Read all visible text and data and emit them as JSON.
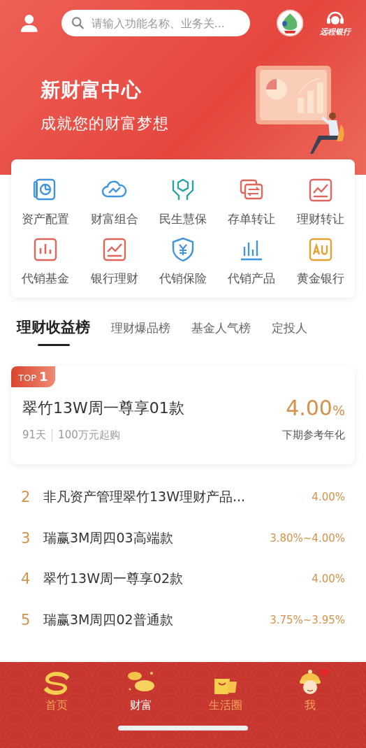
{
  "header": {
    "search": {
      "placeholder": "请输入功能名称、业务关..."
    },
    "remote_bank": "远程银行"
  },
  "banner": {
    "title": "新财富中心",
    "subtitle": "成就您的财富梦想"
  },
  "quick_menu": [
    {
      "label": "资产配置",
      "color": "#3f95dd"
    },
    {
      "label": "财富组合",
      "color": "#3f95dd"
    },
    {
      "label": "民生慧保",
      "color": "#2aa3a3"
    },
    {
      "label": "存单转让",
      "color": "#e0655b"
    },
    {
      "label": "理财转让",
      "color": "#e0655b"
    },
    {
      "label": "代销基金",
      "color": "#e0655b"
    },
    {
      "label": "银行理财",
      "color": "#e0655b"
    },
    {
      "label": "代销保险",
      "color": "#3f95dd"
    },
    {
      "label": "代销产品",
      "color": "#3f95dd"
    },
    {
      "label": "黄金银行",
      "color": "#e6a033"
    }
  ],
  "rank_tabs": [
    {
      "label": "理财收益榜",
      "selected": true
    },
    {
      "label": "理财爆品榜",
      "selected": false
    },
    {
      "label": "基金人气榜",
      "selected": false
    },
    {
      "label": "定投人",
      "selected": false
    }
  ],
  "top_product": {
    "badge_prefix": "TOP",
    "badge_rank": "1",
    "name": "翠竹13W周一尊享01款",
    "rate": "4.00",
    "rate_unit": "%",
    "term": "91天",
    "min_amount": "100万元起购",
    "rate_label": "下期参考年化"
  },
  "rank_list": [
    {
      "rank": "2",
      "name": "非凡资产管理翠竹13W理财产品...",
      "rate": "4.00%"
    },
    {
      "rank": "3",
      "name": "瑞赢3M周四03高端款",
      "rate": "3.80%~4.00%"
    },
    {
      "rank": "4",
      "name": "翠竹13W周一尊享02款",
      "rate": "4.00%"
    },
    {
      "rank": "5",
      "name": "瑞赢3M周四02普通款",
      "rate": "3.75%~3.95%"
    }
  ],
  "bottom_nav": [
    {
      "label": "首页",
      "selected": false,
      "badge": false
    },
    {
      "label": "财富",
      "selected": true,
      "badge": false
    },
    {
      "label": "生活圈",
      "selected": false,
      "badge": false
    },
    {
      "label": "我",
      "selected": false,
      "badge": true
    }
  ]
}
